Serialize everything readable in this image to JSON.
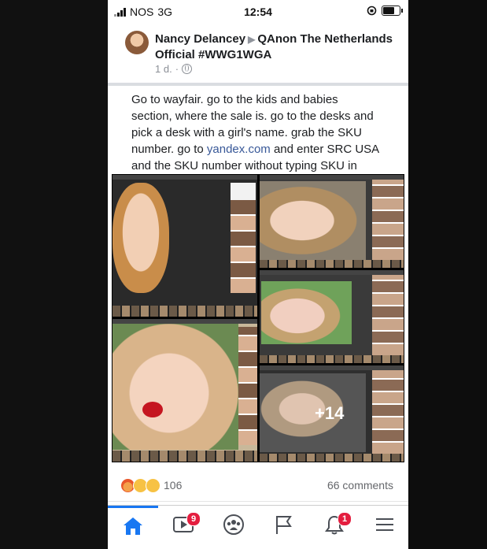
{
  "status_bar": {
    "carrier": "NOS",
    "network": "3G",
    "time": "12:54",
    "battery_level": 0.7
  },
  "post": {
    "author": "Nancy Delancey",
    "group": "QAnon The Netherlands Official #WWG1WGA",
    "age": "1 d.",
    "text_before_link": "Go to wayfair. go to the kids and babies section, where the sale is. go to the desks and pick a desk with a girl's name. grab the SKU number. go to ",
    "link_text": "yandex.com",
    "text_after_link": " and enter SRC USA and the SKU number without typing SKU in front of it.",
    "more_photos": "+14",
    "reactions_count": "106",
    "comments": "66 comments"
  },
  "nav": {
    "video_badge": "9",
    "notifications_badge": "1"
  },
  "colors": {
    "accent": "#1877f2",
    "link": "#385898",
    "badge": "#e41e3f"
  }
}
